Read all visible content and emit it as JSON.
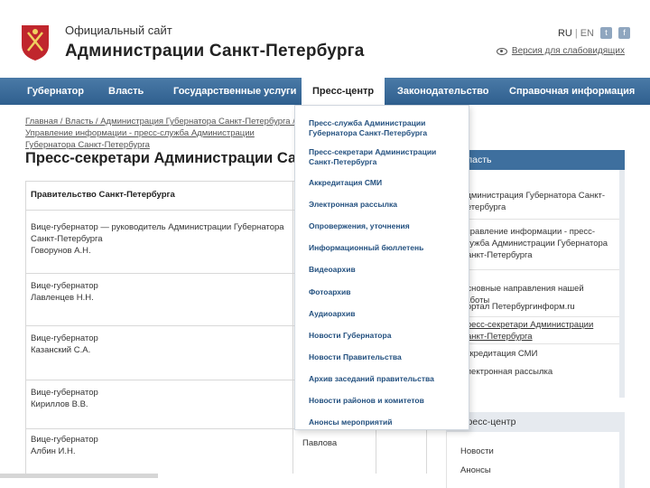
{
  "header": {
    "subtitle": "Официальный сайт",
    "title": "Администрации Санкт-Петербурга",
    "lang_ru": "RU",
    "lang_separator": "|",
    "lang_en": "EN",
    "accessibility_label": "Версия для слабовидящих"
  },
  "nav": {
    "items": [
      "Губернатор",
      "Власть",
      "Государственные услуги",
      "Пресс-центр",
      "Законодательство",
      "Справочная информация"
    ]
  },
  "breadcrumbs": "Главная / Власть / Администрация Губернатора Санкт-Петербурга / Управление информации - пресс-служба Администрации Губернатора Санкт-Петербурга",
  "page_title": "Пресс-секретари Администрации Санкт-Петербурга",
  "table": {
    "header": "Правительство Санкт-Петербурга",
    "rows": [
      {
        "position": "Вице-губернатор — руководитель Администрации Губернатора Санкт-Петербурга",
        "name": "Говорунов А.Н."
      },
      {
        "position": "Вице-губернатор",
        "name": "Лавленцев Н.Н."
      },
      {
        "position": "Вице-губернатор",
        "name": "Казанский С.А."
      },
      {
        "position": "Вице-губернатор",
        "name": "Кириллов В.В."
      },
      {
        "position": "Вице-губернатор",
        "name": "Албин И.Н."
      }
    ],
    "partial_name": "Павлова"
  },
  "dropdown": {
    "items": [
      "Пресс-служба Администрации Губернатора Санкт-Петербурга",
      "Пресс-секретари Администрации Санкт-Петербурга",
      "Аккредитация СМИ",
      "Электронная рассылка",
      "Опровержения, уточнения",
      "Информационный бюллетень",
      "Видеоархив",
      "Фотоархив",
      "Аудиоархив",
      "Новости Губернатора",
      "Новости Правительства",
      "Архив заседаний правительства",
      "Новости районов и комитетов",
      "Анонсы мероприятий"
    ]
  },
  "sidebar": {
    "header1": "Власть",
    "items1": [
      "Администрация Губернатора Санкт-Петербурга",
      "Управление информации - пресс-служба Администрации Губернатора Санкт-Петербурга",
      "Основные направления нашей работы",
      "Портал Петербургинформ.ru",
      "Пресс-секретари Администрации Санкт-Петербурга",
      "Аккредитация СМИ",
      "Электронная рассылка"
    ],
    "header2": "Пресс-центр",
    "items2": [
      "Новости",
      "Анонсы"
    ]
  },
  "colors": {
    "nav_background": "#3a6a99",
    "dropdown_link": "#23507f",
    "sidebar_header": "#3e6f9e"
  }
}
